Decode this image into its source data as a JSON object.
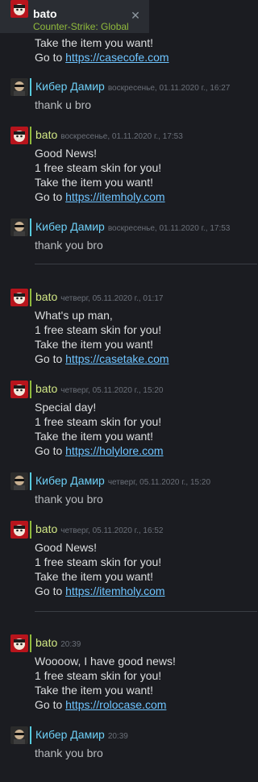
{
  "header": {
    "name": "bato",
    "status": "Counter-Strike: Global Offensive",
    "close": "✕"
  },
  "top_partial": {
    "line1": "Take the item you want!",
    "go_to": "Go to ",
    "link": "https://casecofe.com"
  },
  "messages": [
    {
      "sender": "Кибер Дамир",
      "stamp": "воскресенье, 01.11.2020 г., 16:27",
      "lines": [
        "thank u bro"
      ]
    },
    {
      "sender": "bato",
      "stamp": "воскресенье, 01.11.2020 г., 17:53",
      "lines": [
        "Good News!",
        "1 free steam skin for you!",
        "Take the item you want!"
      ],
      "go_to": "Go to ",
      "link": "https://itemholy.com"
    },
    {
      "sender": "Кибер Дамир",
      "stamp": "воскресенье, 01.11.2020 г., 17:53",
      "lines": [
        "thank you bro"
      ]
    },
    {
      "sender": "bato",
      "stamp": "четверг, 05.11.2020 г., 01:17",
      "lines": [
        "What's up man,",
        "1 free steam skin for you!",
        "Take the item you want!"
      ],
      "go_to": "Go to ",
      "link": "https://casetake.com"
    },
    {
      "sender": "bato",
      "stamp": "четверг, 05.11.2020 г., 15:20",
      "lines": [
        "Special day!",
        "1 free steam skin for you!",
        "Take the item you want!"
      ],
      "go_to": "Go to ",
      "link": "https://holylore.com"
    },
    {
      "sender": "Кибер Дамир",
      "stamp": "четверг, 05.11.2020 г., 15:20",
      "lines": [
        "thank you bro"
      ]
    },
    {
      "sender": "bato",
      "stamp": "четверг, 05.11.2020 г., 16:52",
      "lines": [
        "Good News!",
        "1 free steam skin for you!",
        "Take the item you want!"
      ],
      "go_to": "Go to ",
      "link": "https://itemholy.com"
    },
    {
      "sender": "bato",
      "stamp": "20:39",
      "lines": [
        "Woooow, I have good news!",
        "1 free steam skin for you!",
        "Take the item you want!"
      ],
      "go_to": "Go to ",
      "link": "https://rolocase.com"
    },
    {
      "sender": "Кибер Дамир",
      "stamp": "20:39",
      "lines": [
        "thank you bro"
      ]
    }
  ]
}
